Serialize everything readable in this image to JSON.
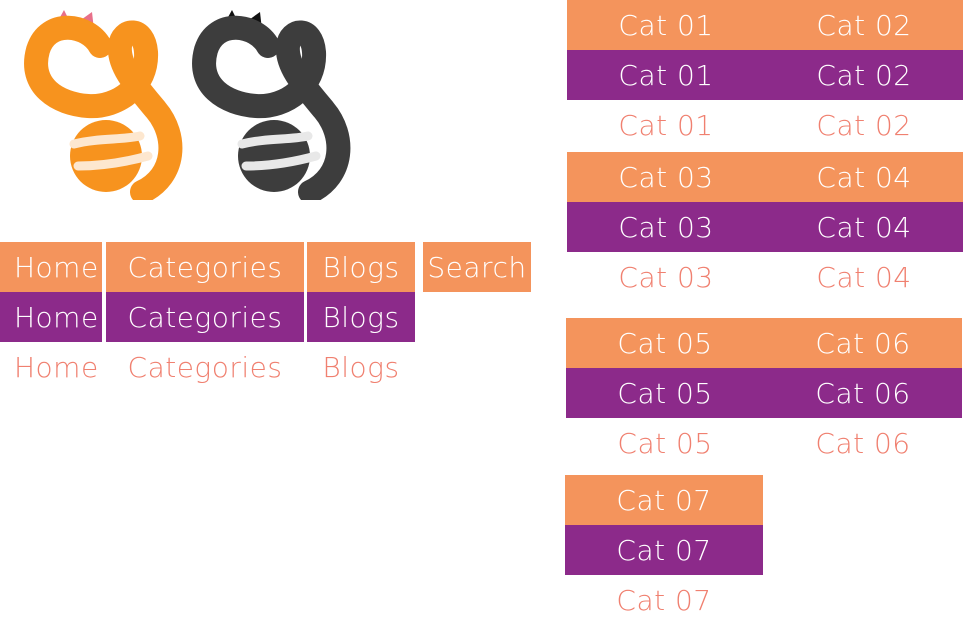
{
  "logos": [
    {
      "name": "logo-orange",
      "body_color": "#f7931e",
      "ear_color": "#e8708a",
      "stripe_color": "#fde7cf"
    },
    {
      "name": "logo-dark",
      "body_color": "#3d3d3d",
      "ear_color": "#111111",
      "stripe_color": "#e8e8e8"
    }
  ],
  "colors": {
    "orange": "#f4945c",
    "purple": "#8c2a8a",
    "plain_text": "#f08070",
    "white": "#ffffff"
  },
  "nav": {
    "home": {
      "label": "Home"
    },
    "categories": {
      "label": "Categories"
    },
    "blogs": {
      "label": "Blogs"
    },
    "search": {
      "label": "Search"
    }
  },
  "categories": [
    {
      "left": "Cat 01",
      "right": "Cat 02"
    },
    {
      "left": "Cat 03",
      "right": "Cat 04"
    },
    {
      "left": "Cat 05",
      "right": "Cat 06"
    },
    {
      "left": "Cat 07"
    }
  ]
}
